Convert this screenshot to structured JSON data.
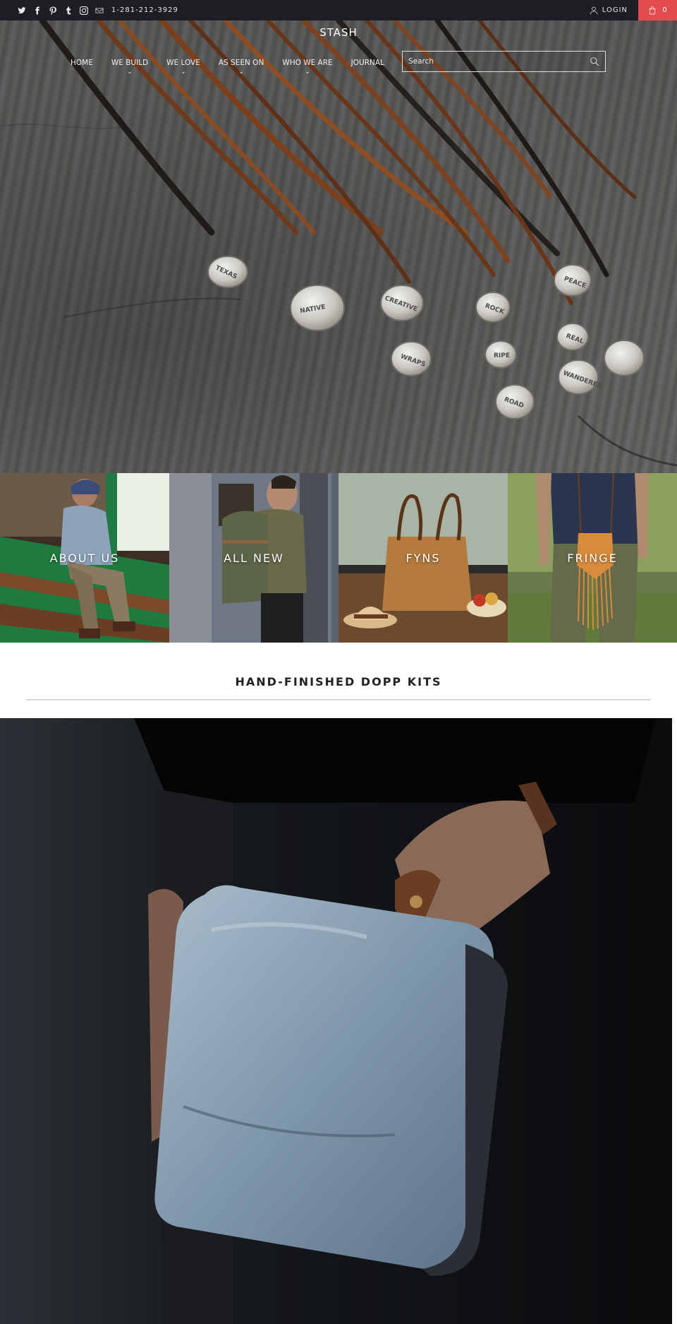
{
  "topbar": {
    "social_icons": [
      "twitter-icon",
      "facebook-icon",
      "pinterest-icon",
      "tumblr-icon",
      "instagram-icon",
      "mail-icon"
    ],
    "phone": "1-281-212-3929",
    "login_label": "LOGIN",
    "cart_count": "0",
    "cart_color": "#e34b4f",
    "background": "#1c1e24"
  },
  "header": {
    "logo": "STASH",
    "nav": [
      {
        "label": "HOME",
        "has_dropdown": false
      },
      {
        "label": "WE BUILD",
        "has_dropdown": true
      },
      {
        "label": "WE LOVE",
        "has_dropdown": true
      },
      {
        "label": "AS SEEN ON",
        "has_dropdown": true
      },
      {
        "label": "WHO WE ARE",
        "has_dropdown": true
      },
      {
        "label": "JOURNAL",
        "has_dropdown": false
      }
    ],
    "search_placeholder": "Search"
  },
  "hero": {
    "medallion_texts": [
      "TEXAS",
      "NATIVE",
      "CREATIVE",
      "WRAPS",
      "ROCK",
      "RIPE",
      "ROAD",
      "REAL",
      "WANDERER",
      "PEACE"
    ]
  },
  "tiles": [
    {
      "label": "ABOUT US"
    },
    {
      "label": "ALL NEW"
    },
    {
      "label": "FYNS"
    },
    {
      "label": "FRINGE"
    }
  ],
  "section": {
    "title": "HAND-FINISHED DOPP KITS"
  }
}
